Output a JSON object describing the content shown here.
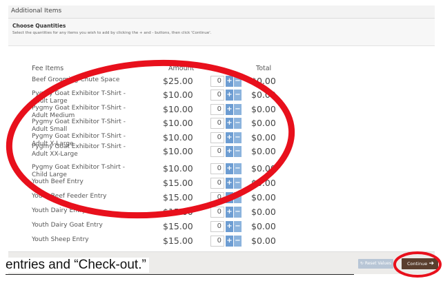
{
  "section_title": "Additional Items",
  "panel": {
    "heading": "Choose Quantities",
    "instructions": "Select the quantities for any items you wish to add by clicking the + and - buttons, then click 'Continue'."
  },
  "columns": {
    "item": "Fee Items",
    "amount": "Amount",
    "total": "Total"
  },
  "items": [
    {
      "name": "Beef Grooming Chute Space",
      "amount": "$25.00",
      "qty": "0",
      "total": "$0.00"
    },
    {
      "name": "Pygmy Goat Exhibitor T-Shirt - Adult Large",
      "amount": "$10.00",
      "qty": "0",
      "total": "$0.00"
    },
    {
      "name": "Pygmy Goat Exhibitor T-Shirt - Adult Medium",
      "amount": "$10.00",
      "qty": "0",
      "total": "$0.00"
    },
    {
      "name": "Pygmy Goat Exhibitor T-Shirt - Adult Small",
      "amount": "$10.00",
      "qty": "0",
      "total": "$0.00"
    },
    {
      "name": "Pygmy Goat Exhibitor T-Shirt - Adult X-Large",
      "amount": "$10.00",
      "qty": "0",
      "total": "$0.00"
    },
    {
      "name": "Pygmy Goat Exhibitor T-Shirt - Adult XX-Large",
      "amount": "$10.00",
      "qty": "0",
      "total": "$0.00"
    },
    {
      "name": "Pygmy Goat Exhibitor T-shirt - Child Large",
      "amount": "$10.00",
      "qty": "0",
      "total": "$0.00"
    },
    {
      "name": "Youth Beef Entry",
      "amount": "$15.00",
      "qty": "0",
      "total": "$0.00"
    },
    {
      "name": "Youth Beef Feeder Entry",
      "amount": "$15.00",
      "qty": "0",
      "total": "$0.00"
    },
    {
      "name": "Youth Dairy Entry",
      "amount": "$15.00",
      "qty": "0",
      "total": "$0.00"
    },
    {
      "name": "Youth Dairy Goat Entry",
      "amount": "$15.00",
      "qty": "0",
      "total": "$0.00"
    },
    {
      "name": "Youth Sheep Entry",
      "amount": "$15.00",
      "qty": "0",
      "total": "$0.00"
    }
  ],
  "buttons": {
    "plus": "+",
    "minus": "−",
    "reset": "Reset Values",
    "continue": "Continue"
  },
  "caption": "entries and “Check-out.”",
  "colors": {
    "annotation": "#e8101c",
    "continue_bg": "#5a3e2e",
    "stepper": "#6d9dd2"
  }
}
